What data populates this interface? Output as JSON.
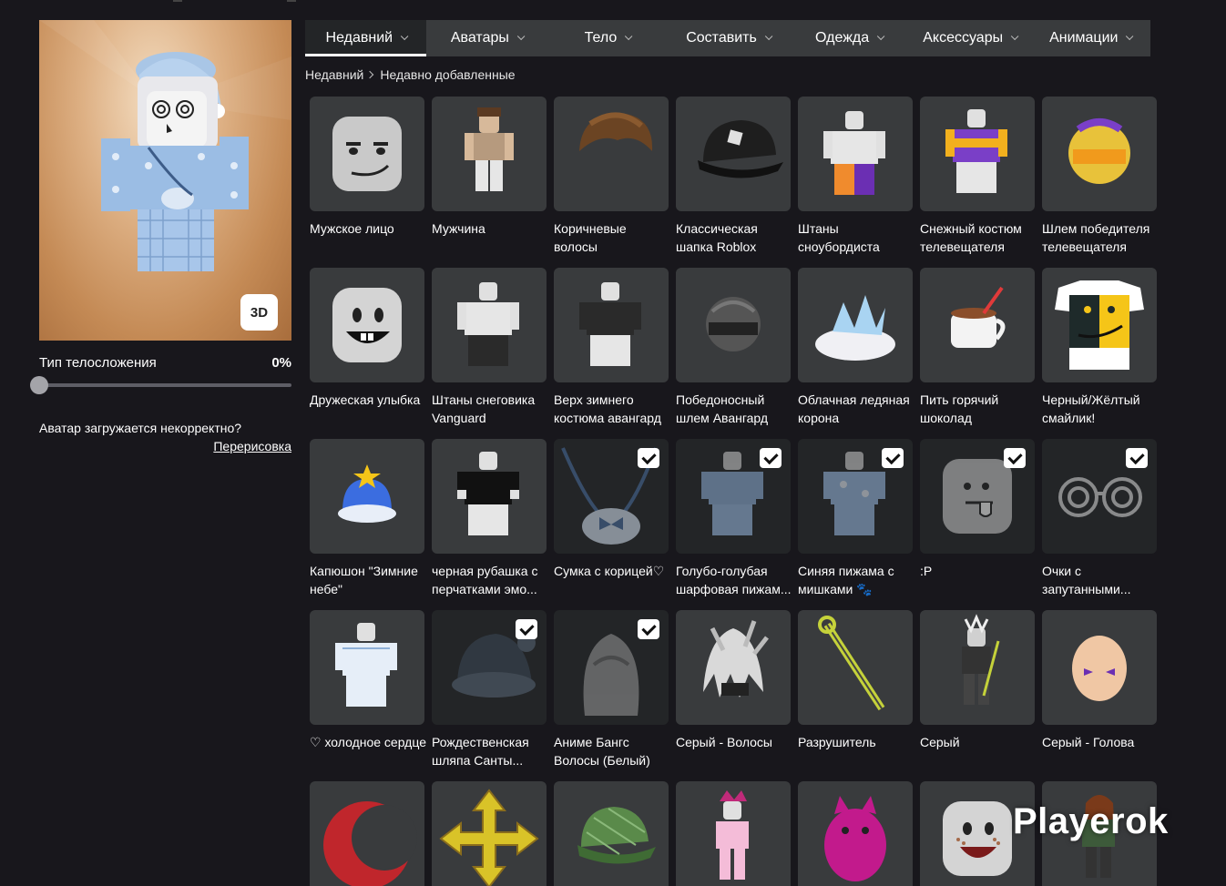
{
  "avatar": {
    "btn_3d": "3D",
    "body_type_label": "Тип телосложения",
    "body_type_value": "0%",
    "body_type_level": 0,
    "warning": "Аватар загружается некорректно?",
    "redraw_link": "Перерисовка"
  },
  "tabs": [
    {
      "label": "Недавний",
      "active": true
    },
    {
      "label": "Аватары",
      "active": false
    },
    {
      "label": "Тело",
      "active": false
    },
    {
      "label": "Составить",
      "active": false
    },
    {
      "label": "Одежда",
      "active": false
    },
    {
      "label": "Аксессуары",
      "active": false
    },
    {
      "label": "Анимации",
      "active": false
    }
  ],
  "breadcrumb": {
    "root": "Недавний",
    "current": "Недавно добавленные"
  },
  "items": [
    {
      "name": "Мужское лицо",
      "icon": "man-face-icon",
      "worn": false
    },
    {
      "name": "Мужчина",
      "icon": "man-package-icon",
      "worn": false
    },
    {
      "name": "Коричневые волосы",
      "icon": "brown-hair-icon",
      "worn": false
    },
    {
      "name": "Классическая шапка Roblox",
      "icon": "roblox-cap-icon",
      "worn": false
    },
    {
      "name": "Штаны сноубордиста телевещателя",
      "icon": "broadcaster-pants-icon",
      "worn": false
    },
    {
      "name": "Снежный костюм телевещателя",
      "icon": "snowsuit-icon",
      "worn": false
    },
    {
      "name": "Шлем победителя телевещателя",
      "icon": "winner-helmet-icon",
      "worn": false
    },
    {
      "name": "Дружеская улыбка",
      "icon": "friendly-smile-face-icon",
      "worn": false
    },
    {
      "name": "Штаны снеговика Vanguard",
      "icon": "vanguard-pants-icon",
      "worn": false
    },
    {
      "name": "Верх зимнего костюма авангард",
      "icon": "vanguard-top-icon",
      "worn": false
    },
    {
      "name": "Победоносный шлем Авангард",
      "icon": "vanguard-helmet-icon",
      "worn": false
    },
    {
      "name": "Облачная ледяная корона",
      "icon": "cloud-crown-icon",
      "worn": false
    },
    {
      "name": "Пить горячий шоколад",
      "icon": "hot-chocolate-icon",
      "worn": false
    },
    {
      "name": "Черный/Жёлтый смайлик!",
      "icon": "smiley-tshirt-icon",
      "worn": false
    },
    {
      "name": "Капюшон \"Зимние небе\"",
      "icon": "winter-hood-icon",
      "worn": false
    },
    {
      "name": "черная рубашка с перчатками эмо...",
      "icon": "black-shirt-icon",
      "worn": false
    },
    {
      "name": "Сумка с корицей♡",
      "icon": "cinnamon-bag-icon",
      "worn": true
    },
    {
      "name": "Голубо-голубая шарфовая пижам...",
      "icon": "blue-pajama-icon",
      "worn": true
    },
    {
      "name": "Синяя пижама с мишками 🐾",
      "icon": "bear-pajama-icon",
      "worn": true
    },
    {
      "name": ":P",
      "icon": "tongue-face-icon",
      "worn": true
    },
    {
      "name": "Очки с запутанными...",
      "icon": "spiral-glasses-icon",
      "worn": true
    },
    {
      "name": "♡ холодное сердце",
      "icon": "cold-heart-icon",
      "worn": false
    },
    {
      "name": "Рождественская шляпа Санты...",
      "icon": "santa-hat-icon",
      "worn": true
    },
    {
      "name": "Аниме Бангс Волосы (Белый)",
      "icon": "anime-hair-icon",
      "worn": true
    },
    {
      "name": "Серый - Волосы",
      "icon": "gray-hair-icon",
      "worn": false
    },
    {
      "name": "Разрушитель",
      "icon": "destroyer-sword-icon",
      "worn": false
    },
    {
      "name": "Серый",
      "icon": "gray-package-icon",
      "worn": false
    },
    {
      "name": "Серый - Голова",
      "icon": "gray-head-icon",
      "worn": false
    },
    {
      "name": "",
      "icon": "red-crescent-icon",
      "worn": false
    },
    {
      "name": "",
      "icon": "yellow-arrows-icon",
      "worn": false
    },
    {
      "name": "",
      "icon": "green-plaid-cap-icon",
      "worn": false
    },
    {
      "name": "",
      "icon": "pink-outfit-icon",
      "worn": false
    },
    {
      "name": "",
      "icon": "pink-creature-icon",
      "worn": false
    },
    {
      "name": "",
      "icon": "freckle-face-icon",
      "worn": false
    },
    {
      "name": "",
      "icon": "girl-package-icon",
      "worn": false
    }
  ],
  "watermark": "Playerok"
}
